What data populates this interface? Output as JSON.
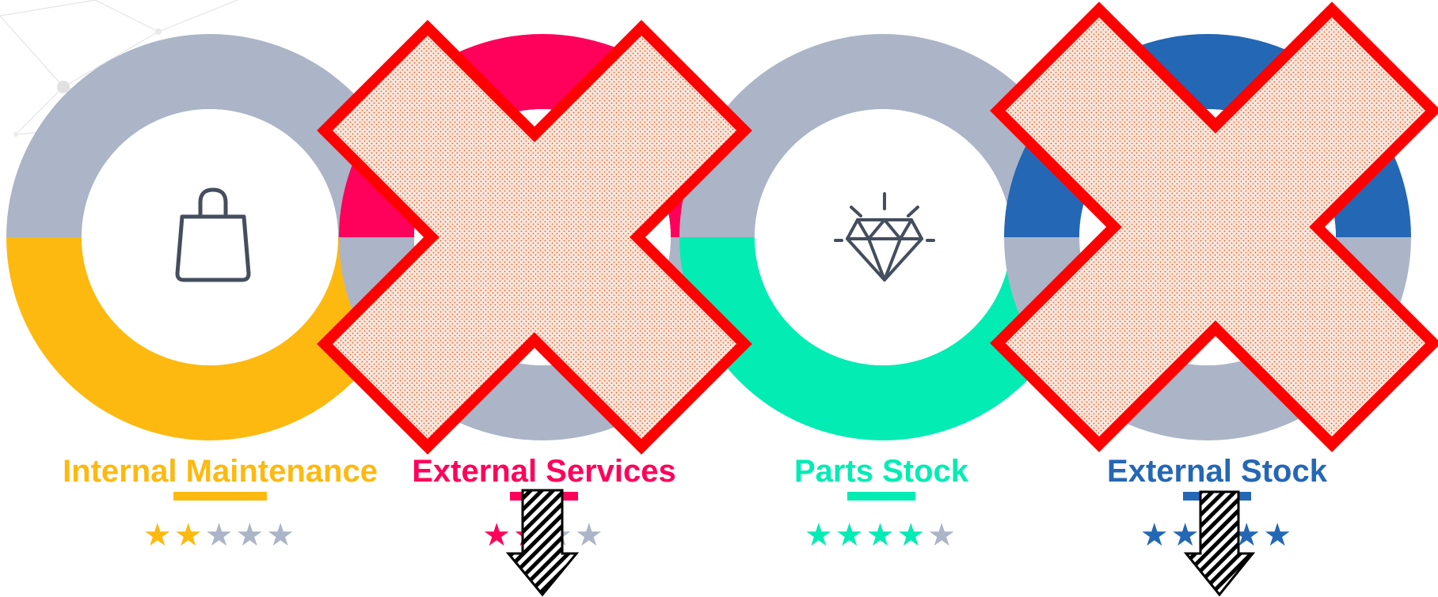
{
  "colors": {
    "track": "#abb5c7",
    "icon": "#444e5e",
    "cross_fill": "#fbe7dc",
    "cross_dots": "#e05a2a",
    "cross_stroke": "#ff0000"
  },
  "items": [
    {
      "name": "Internal Maintenance",
      "color": "#fdb90f",
      "rating": 2,
      "max_rating": 5,
      "icon": "shopping-bag-icon",
      "stars": "★★★★★"
    },
    {
      "name": "External Services",
      "color": "#ff005a",
      "rating": 2,
      "max_rating": 5,
      "icon": "hidden",
      "stars": "★★★★"
    },
    {
      "name": "Parts Stock",
      "color": "#02ecb4",
      "rating": 4,
      "max_rating": 5,
      "icon": "diamond-icon",
      "stars": "★★★★★"
    },
    {
      "name": "External Stock",
      "color": "#2467b5",
      "rating": 5,
      "max_rating": 5,
      "icon": "hidden",
      "stars": "★★★★★"
    }
  ]
}
